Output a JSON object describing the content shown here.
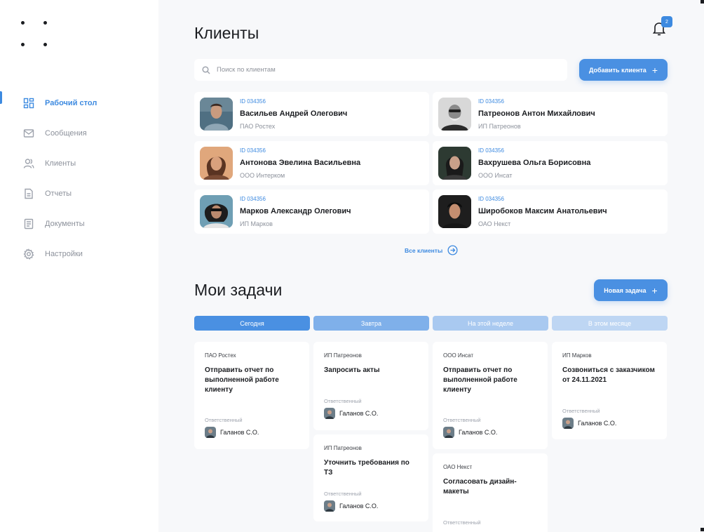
{
  "sidebar": {
    "nav": [
      {
        "label": "Рабочий стол",
        "icon": "dashboard-icon",
        "active": true
      },
      {
        "label": "Сообщения",
        "icon": "mail-icon",
        "active": false
      },
      {
        "label": "Клиенты",
        "icon": "users-icon",
        "active": false
      },
      {
        "label": "Отчеты",
        "icon": "report-icon",
        "active": false
      },
      {
        "label": "Документы",
        "icon": "document-icon",
        "active": false
      },
      {
        "label": "Настройки",
        "icon": "gear-icon",
        "active": false
      }
    ]
  },
  "header": {
    "title": "Клиенты",
    "notifications_count": "2"
  },
  "search": {
    "placeholder": "Поиск по клиентам",
    "value": ""
  },
  "buttons": {
    "add_client": "Добавить клиента",
    "new_task": "Новая задача",
    "all_clients": "Все клиенты"
  },
  "clients": [
    {
      "id": "ID 034356",
      "name": "Васильев Андрей Олегович",
      "company": "ПАО Ростех",
      "avatar_color": "#5a7a8c"
    },
    {
      "id": "ID 034356",
      "name": "Патреонов Антон Михайлович",
      "company": "ИП Патреонов",
      "avatar_color": "#6e6e6e"
    },
    {
      "id": "ID 034356",
      "name": "Антонова Эвелина Васильевна",
      "company": "ООО Интерком",
      "avatar_color": "#c98a5e"
    },
    {
      "id": "ID 034356",
      "name": "Вахрушева Ольга Борисовна",
      "company": "ООО Инсат",
      "avatar_color": "#3a3a3a"
    },
    {
      "id": "ID 034356",
      "name": "Марков Александр Олегович",
      "company": "ИП Марков",
      "avatar_color": "#4f7f95"
    },
    {
      "id": "ID 034356",
      "name": "Широбоков Максим Анатольевич",
      "company": "ОАО Некст",
      "avatar_color": "#2c2c2c"
    }
  ],
  "tasks_section": {
    "title": "Мои задачи",
    "tabs": [
      {
        "label": "Сегодня",
        "color": "#4a90e2"
      },
      {
        "label": "Завтра",
        "color": "#7fb0ea"
      },
      {
        "label": "На этой неделе",
        "color": "#a9c9f0"
      },
      {
        "label": "В этом месяце",
        "color": "#bed6f3"
      }
    ],
    "responsible_label": "Ответственный",
    "tasks": [
      {
        "company": "ПАО Ростех",
        "title": "Отправить отчет по выполненной работе клиенту",
        "responsible": "Галанов С.О."
      },
      {
        "company": "ИП Патреонов",
        "title": "Запросить акты",
        "responsible": "Галанов С.О."
      },
      {
        "company": "ООО Инсат",
        "title": "Отправить отчет по выполненной работе клиенту",
        "responsible": "Галанов С.О."
      },
      {
        "company": "ИП Марков",
        "title": "Созвониться с заказчиком от 24.11.2021",
        "responsible": "Галанов С.О."
      },
      {
        "company": "ИП Патреонов",
        "title": "Уточнить требования по ТЗ",
        "responsible": "Галанов С.О."
      },
      {
        "company": "ОАО Некст",
        "title": "Согласовать дизайн-макеты",
        "responsible": ""
      }
    ]
  }
}
